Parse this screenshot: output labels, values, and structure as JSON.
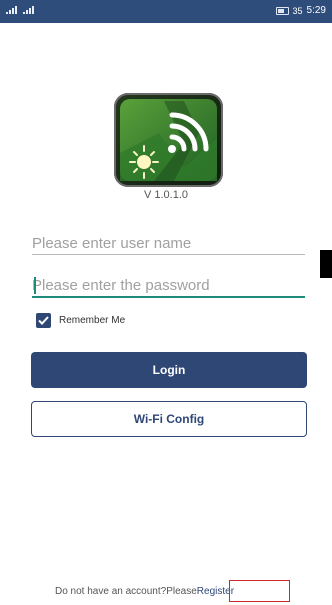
{
  "status_bar": {
    "time": "5:29",
    "battery_indicator": "35",
    "icons": [
      "signal-icon",
      "signal-icon",
      "battery-icon"
    ]
  },
  "logo": {
    "icon": "wifi-sun-logo-icon"
  },
  "version": "V 1.0.1.0",
  "form": {
    "username_placeholder": "Please enter user name",
    "password_placeholder": "Please enter the password",
    "remember_label": "Remember Me",
    "remember_checked": true
  },
  "buttons": {
    "login": "Login",
    "wifi_config": "Wi-Fi Config"
  },
  "footer": {
    "prompt": "Do not have an account?Please",
    "register": "Register"
  },
  "colors": {
    "primary": "#2e4775",
    "status_bar": "#2e4d7a",
    "focus_accent": "#1d8c7a",
    "highlight_box": "#cc2a2a"
  }
}
